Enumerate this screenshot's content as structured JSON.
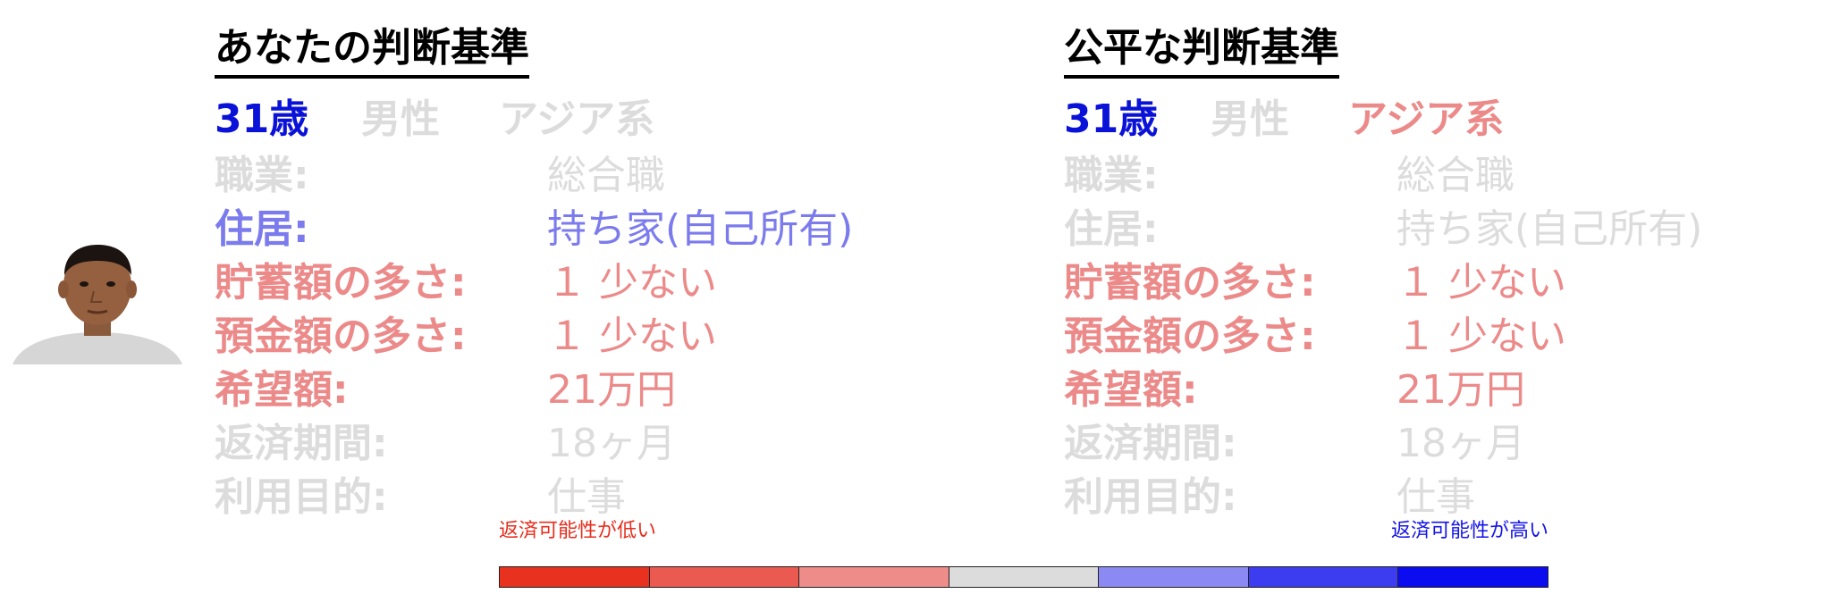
{
  "left_panel": {
    "title": "あなたの判断基準",
    "age": "31歳",
    "gender": "男性",
    "ethnicity": "アジア系",
    "rows": [
      {
        "label": "職業:",
        "value": "総合職",
        "tone": "gray"
      },
      {
        "label": "住居:",
        "value": "持ち家(自己所有)",
        "tone": "lblue"
      },
      {
        "label": "貯蓄額の多さ:",
        "value": "１ 少ない",
        "tone": "red"
      },
      {
        "label": "預金額の多さ:",
        "value": "１ 少ない",
        "tone": "red"
      },
      {
        "label": "希望額:",
        "value": "21万円",
        "tone": "red"
      },
      {
        "label": "返済期間:",
        "value": "18ヶ月",
        "tone": "gray"
      },
      {
        "label": "利用目的:",
        "value": "仕事",
        "tone": "gray"
      }
    ]
  },
  "right_panel": {
    "title": "公平な判断基準",
    "age": "31歳",
    "gender": "男性",
    "ethnicity": "アジア系",
    "rows": [
      {
        "label": "職業:",
        "value": "総合職",
        "tone": "gray"
      },
      {
        "label": "住居:",
        "value": "持ち家(自己所有)",
        "tone": "gray"
      },
      {
        "label": "貯蓄額の多さ:",
        "value": "１ 少ない",
        "tone": "red"
      },
      {
        "label": "預金額の多さ:",
        "value": "１ 少ない",
        "tone": "red"
      },
      {
        "label": "希望額:",
        "value": "21万円",
        "tone": "red"
      },
      {
        "label": "返済期間:",
        "value": "18ヶ月",
        "tone": "gray"
      },
      {
        "label": "利用目的:",
        "value": "仕事",
        "tone": "gray"
      }
    ]
  },
  "legend": {
    "low_label": "返済可能性が低い",
    "high_label": "返済可能性が高い",
    "colors": [
      "#e8321f",
      "#eb5a50",
      "#ee8c8a",
      "#dcdcdc",
      "#8a8af2",
      "#3c3cf0",
      "#0c0cf0"
    ]
  },
  "colors": {
    "gray": "#dcdcdc",
    "blue": "#0a12d8",
    "lblue": "#7b7bee",
    "red": "#ec8a8a"
  }
}
